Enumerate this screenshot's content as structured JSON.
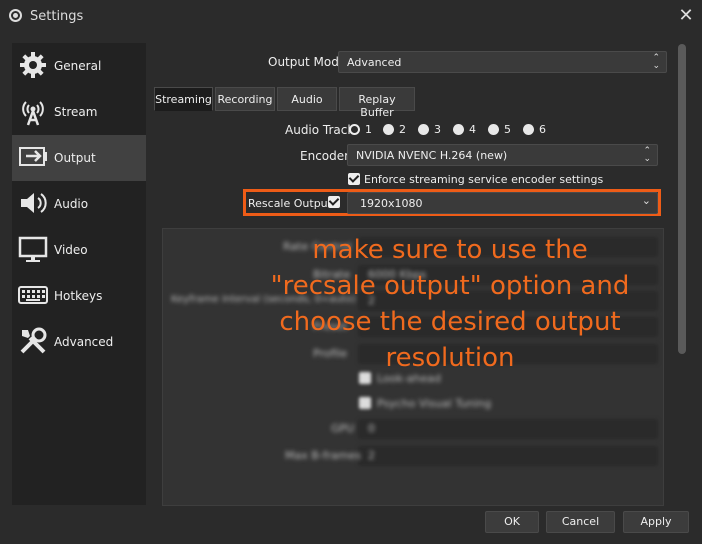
{
  "window": {
    "title": "Settings",
    "close_icon": "✕"
  },
  "sidebar": {
    "items": [
      {
        "label": "General",
        "icon": "gear-icon"
      },
      {
        "label": "Stream",
        "icon": "broadcast-icon"
      },
      {
        "label": "Output",
        "icon": "output-icon",
        "active": true
      },
      {
        "label": "Audio",
        "icon": "speaker-icon"
      },
      {
        "label": "Video",
        "icon": "monitor-icon"
      },
      {
        "label": "Hotkeys",
        "icon": "keyboard-icon"
      },
      {
        "label": "Advanced",
        "icon": "tools-icon"
      }
    ]
  },
  "output": {
    "mode_label": "Output Mode",
    "mode_value": "Advanced",
    "tabs": [
      "Streaming",
      "Recording",
      "Audio",
      "Replay Buffer"
    ],
    "active_tab": "Streaming",
    "audio_track_label": "Audio Track",
    "audio_tracks": [
      "1",
      "2",
      "3",
      "4",
      "5",
      "6"
    ],
    "selected_audio_track": "1",
    "encoder_label": "Encoder",
    "encoder_value": "NVIDIA NVENC H.264 (new)",
    "enforce_label": "Enforce streaming service encoder settings",
    "enforce_checked": true,
    "rescale_label": "Rescale Output",
    "rescale_checked": true,
    "rescale_value": "1920x1080"
  },
  "annotation": {
    "text": "make sure to use the \"recsale output\" option and choose the desired output resolution",
    "color": "#f06a1e"
  },
  "blurred_settings": {
    "rows": [
      {
        "label": "Rate Control"
      },
      {
        "label": "Bitrate",
        "value": "6000 Kbps"
      },
      {
        "label": "Keyframe Interval (seconds, 0=auto)",
        "value": "2"
      },
      {
        "label": "Preset"
      },
      {
        "label": "Profile"
      },
      {
        "label": "Look-ahead"
      },
      {
        "label": "Psycho Visual Tuning"
      },
      {
        "label": "GPU",
        "value": "0"
      },
      {
        "label": "Max B-frames",
        "value": "2"
      }
    ]
  },
  "buttons": {
    "ok": "OK",
    "cancel": "Cancel",
    "apply": "Apply"
  }
}
